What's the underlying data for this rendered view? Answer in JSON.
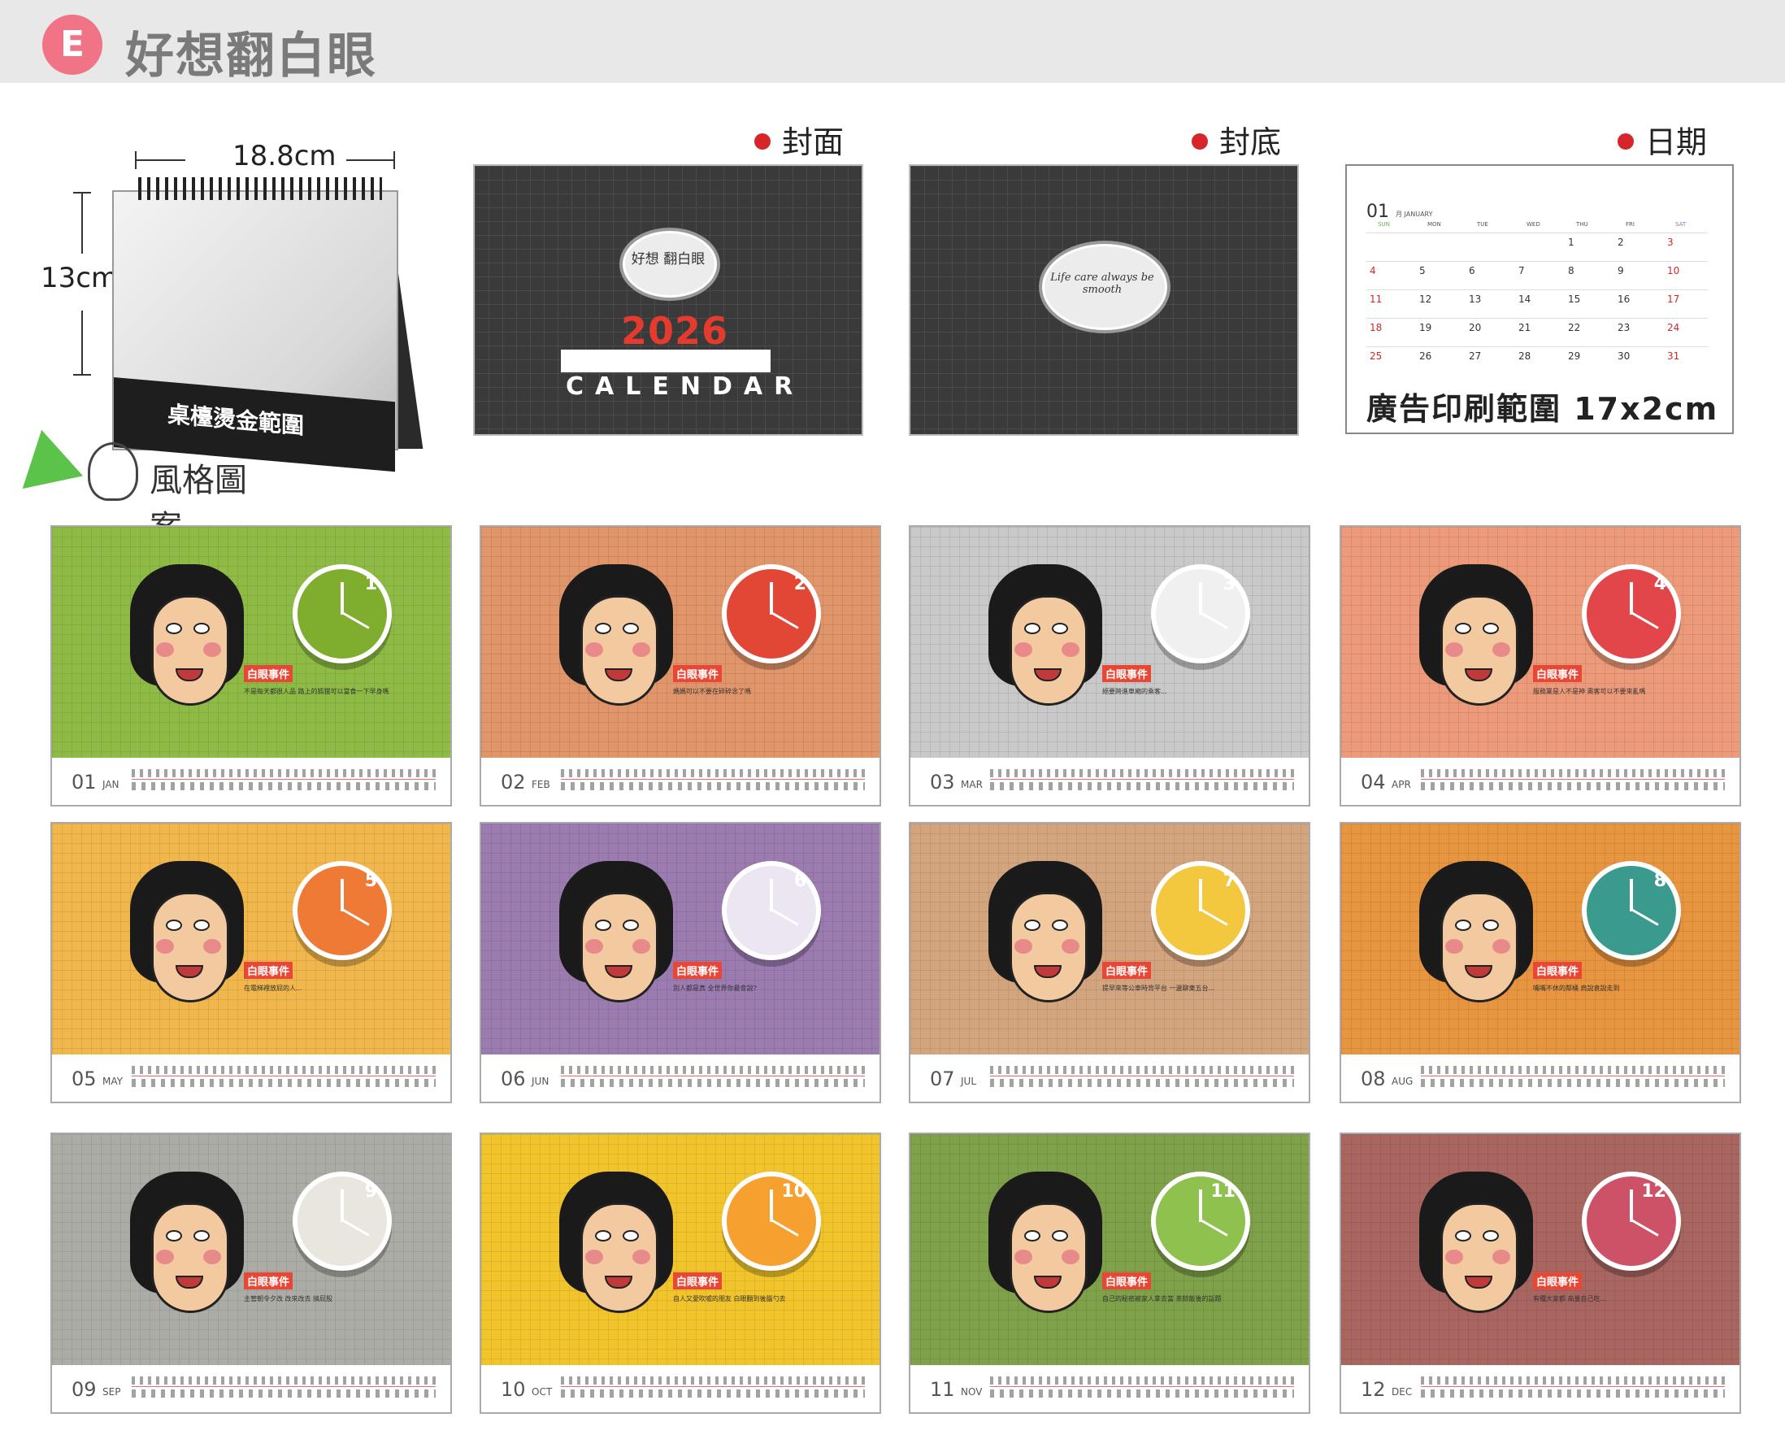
{
  "header": {
    "badge": "E",
    "title": "好想翻白眼"
  },
  "desk": {
    "width_label": "18.8cm",
    "height_label": "13cm",
    "stamp_label": "桌檯燙金範圍",
    "style_label": "風格圖案"
  },
  "panels": {
    "cover_label": "封面",
    "back_label": "封底",
    "date_label": "日期",
    "cover_bubble": "好想 翻白眼",
    "cover_year": "2026",
    "cover_word": "CALENDAR",
    "back_bubble": "Life care always be smooth",
    "date_month_no": "01",
    "date_month_name": "月 JANUARY",
    "date_days": [
      "SUN",
      "MON",
      "TUE",
      "WED",
      "THU",
      "FRI",
      "SAT"
    ],
    "date_rows": [
      [
        "",
        "",
        "",
        "",
        "1",
        "2",
        "3"
      ],
      [
        "4",
        "5",
        "6",
        "7",
        "8",
        "9",
        "10"
      ],
      [
        "11",
        "12",
        "13",
        "14",
        "15",
        "16",
        "17"
      ],
      [
        "18",
        "19",
        "20",
        "21",
        "22",
        "23",
        "24"
      ],
      [
        "25",
        "26",
        "27",
        "28",
        "29",
        "30",
        "31"
      ]
    ],
    "ad_label": "廣告印刷範圍 17x2cm"
  },
  "months": [
    {
      "num": "01",
      "abbr": "JAN",
      "color": "#8dbb45",
      "clock_color": "#7fae2f",
      "clock_num": "1",
      "tag": "白眼事件",
      "text": "不是每天都很人品 路上的狐狸可以當食一下早身嗎"
    },
    {
      "num": "02",
      "abbr": "FEB",
      "color": "#e0956a",
      "clock_color": "#e24735",
      "clock_num": "2",
      "tag": "白眼事件",
      "text": "媽媽可以不要在碎碎念了嗎"
    },
    {
      "num": "03",
      "abbr": "MAR",
      "color": "#c9c9c9",
      "clock_color": "#f0f0f0",
      "clock_num": "3",
      "tag": "白眼事件",
      "text": "絕要跨進車廂的乘客..."
    },
    {
      "num": "04",
      "abbr": "APR",
      "color": "#ec9a79",
      "clock_color": "#e2454a",
      "clock_num": "4",
      "tag": "白眼事件",
      "text": "服務業是人不是神 奧客可以不要來亂嗎"
    },
    {
      "num": "05",
      "abbr": "MAY",
      "color": "#f1b64c",
      "clock_color": "#ef7a35",
      "clock_num": "5",
      "tag": "白眼事件",
      "text": "在電梯裡放屁的人..."
    },
    {
      "num": "06",
      "abbr": "JUN",
      "color": "#9b7bb0",
      "clock_color": "#ece6f2",
      "clock_num": "6",
      "tag": "白眼事件",
      "text": "別人都是真 全世界你最會說?"
    },
    {
      "num": "07",
      "abbr": "JUL",
      "color": "#d3a57f",
      "clock_color": "#f3c83f",
      "clock_num": "7",
      "tag": "白眼事件",
      "text": "提早來等公車時背平台 一邊聊東五台..."
    },
    {
      "num": "08",
      "abbr": "AUG",
      "color": "#e8953f",
      "clock_color": "#3a9a8e",
      "clock_num": "8",
      "tag": "白眼事件",
      "text": "嘴嘴不休的鄰桶 肩說袁說走到"
    },
    {
      "num": "09",
      "abbr": "SEP",
      "color": "#acaca6",
      "clock_color": "#e9e6df",
      "clock_num": "9",
      "tag": "白眼事件",
      "text": "主管朝令夕改 改來改去 搞屁股"
    },
    {
      "num": "10",
      "abbr": "OCT",
      "color": "#f2c42c",
      "clock_color": "#f6a030",
      "clock_num": "10",
      "tag": "白眼事件",
      "text": "自人又愛吹噓的朋友 白眼翻到後腦勺去"
    },
    {
      "num": "11",
      "abbr": "NOV",
      "color": "#7ea14a",
      "clock_color": "#8fc14e",
      "clock_num": "11",
      "tag": "白眼事件",
      "text": "自己的秘密被家人拿去當 茶餘飯後的話題"
    },
    {
      "num": "12",
      "abbr": "DEC",
      "color": "#a96660",
      "clock_color": "#cd5268",
      "clock_num": "12",
      "tag": "白眼事件",
      "text": "有種大家都 商量自己吃..."
    }
  ]
}
